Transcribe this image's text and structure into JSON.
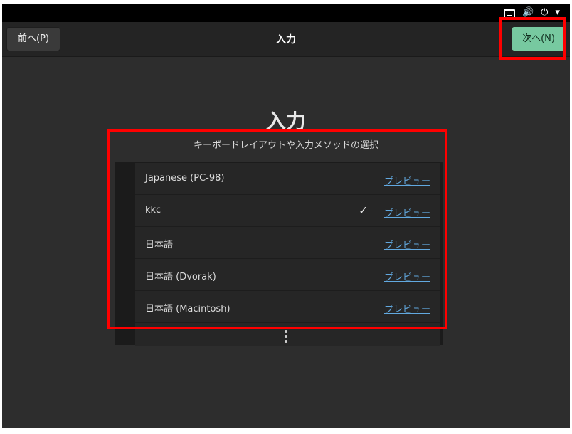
{
  "panel": {
    "icons": [
      "network-icon",
      "volume-icon",
      "power-icon",
      "chevron-down-icon"
    ]
  },
  "header": {
    "back_label": "前へ(P)",
    "title": "入力",
    "next_label": "次へ(N)"
  },
  "main": {
    "title": "入力",
    "subtitle": "キーボードレイアウトや入力メソッドの選択"
  },
  "layouts": [
    {
      "label": "Japanese (PC-98)",
      "preview": "プレビュー",
      "checked": false
    },
    {
      "label": "kkc",
      "preview": "プレビュー",
      "checked": true
    },
    {
      "label": "日本語",
      "preview": "プレビュー",
      "checked": false
    },
    {
      "label": "日本語 (Dvorak)",
      "preview": "プレビュー",
      "checked": false
    },
    {
      "label": "日本語 (Macintosh)",
      "preview": "プレビュー",
      "checked": false
    }
  ],
  "check_glyph": "✓",
  "colors": {
    "accent": "#77c9a0",
    "highlight": "#ff0000",
    "link": "#62a9e0"
  }
}
